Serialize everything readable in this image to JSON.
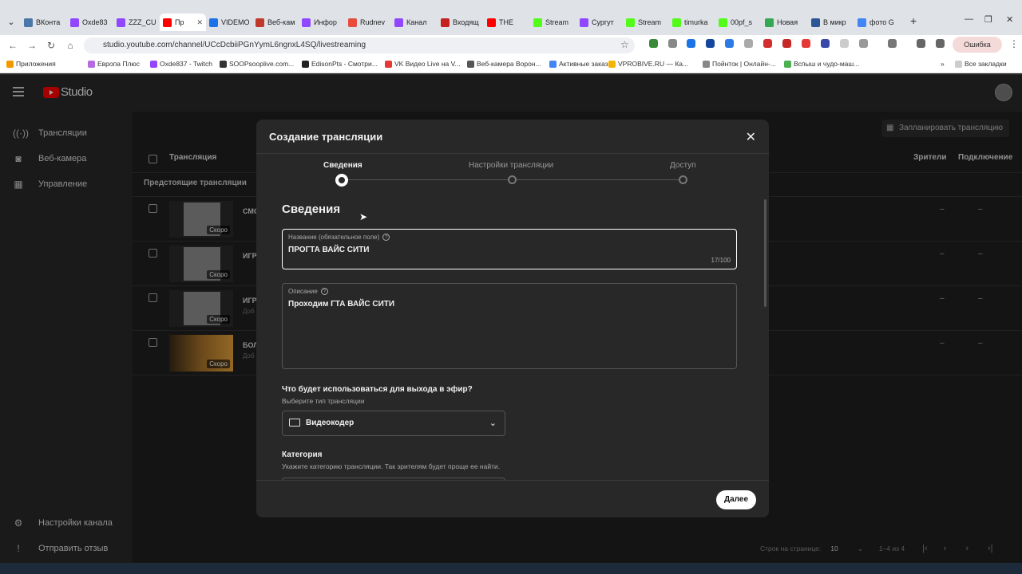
{
  "browser": {
    "tabs": [
      {
        "label": "ВКонта",
        "color": "#4a76a8"
      },
      {
        "label": "Oxde83",
        "color": "#9146ff"
      },
      {
        "label": "ZZZ_CU",
        "color": "#9146ff"
      },
      {
        "label": "Пр",
        "color": "#ff0000",
        "active": true
      },
      {
        "label": "VIDEMO",
        "color": "#1a73e8"
      },
      {
        "label": "Веб-кам",
        "color": "#c0392b"
      },
      {
        "label": "Инфор",
        "color": "#9146ff"
      },
      {
        "label": "Rudnev",
        "color": "#e84c3d"
      },
      {
        "label": "Канал",
        "color": "#9146ff"
      },
      {
        "label": "Входящ",
        "color": "#c5221f"
      },
      {
        "label": "THE",
        "color": "#ff0000"
      },
      {
        "label": "Stream",
        "color": "#53fc18"
      },
      {
        "label": "Сургут",
        "color": "#9146ff"
      },
      {
        "label": "Stream",
        "color": "#53fc18"
      },
      {
        "label": "timurka",
        "color": "#53fc18"
      },
      {
        "label": "00pf_s",
        "color": "#53fc18"
      },
      {
        "label": "Новая",
        "color": "#34a853"
      },
      {
        "label": "В микр",
        "color": "#2b5797"
      },
      {
        "label": "фото G",
        "color": "#4285f4"
      }
    ],
    "url": "studio.youtube.com/channel/UCcDcbiiPGnYymL6ngnxL4SQ/livestreaming",
    "error_label": "Ошибка",
    "bookmarks": [
      "Приложения",
      "Европа Плюс",
      "Oxde837 - Twitch",
      "SOOPsooplive.com...",
      "EdisonPts - Смотри...",
      "VK Видео Live на V...",
      "Веб-камера Ворон...",
      "Активные заказы",
      "VPROBIVE.RU — Ка...",
      "Пойнток | Онлайн-...",
      "Вспыш и чудо-маш..."
    ],
    "all_bookmarks": "Все закладки"
  },
  "studio": {
    "logo_text": "Studio",
    "sidebar": {
      "items": [
        {
          "label": "Трансляции",
          "icon": "broadcast-icon"
        },
        {
          "label": "Веб-камера",
          "icon": "camera-icon"
        },
        {
          "label": "Управление",
          "icon": "calendar-icon"
        }
      ],
      "bottom": [
        {
          "label": "Настройки канала",
          "icon": "gear-icon"
        },
        {
          "label": "Отправить отзыв",
          "icon": "feedback-icon"
        }
      ]
    },
    "schedule_button": "Запланировать трансляцию",
    "table": {
      "col_title": "Трансляция",
      "col_viewers": "Зрители",
      "col_connection": "Подключение",
      "group_label": "Предстоящие трансляции",
      "rows": [
        {
          "title": "СМО",
          "sub": "",
          "badge": "Скоро",
          "viewers": "–",
          "connection": "–"
        },
        {
          "title": "ИГРА",
          "sub": "",
          "badge": "Скоро",
          "viewers": "–",
          "connection": "–"
        },
        {
          "title": "ИГРА",
          "sub": "Доб",
          "badge": "Скоро",
          "viewers": "–",
          "connection": "–"
        },
        {
          "title": "БОЛ",
          "sub": "Доб",
          "badge": "Скоро",
          "viewers": "–",
          "connection": "–"
        }
      ]
    },
    "footer": {
      "rows_per_page_label": "Строк на странице:",
      "rows_per_page": "10",
      "range": "1–4 из 4"
    }
  },
  "modal": {
    "title": "Создание трансляции",
    "steps": [
      "Сведения",
      "Настройки трансляции",
      "Доступ"
    ],
    "active_step": 0,
    "section_title": "Сведения",
    "title_field": {
      "label": "Название (обязательное поле)",
      "value": "ПРОГТА ВАЙС СИТИ",
      "counter": "17/100"
    },
    "description_field": {
      "label": "Описание",
      "value": "Проходим ГТА ВАЙС СИТИ"
    },
    "output_question": "Что будет использоваться для выхода в эфир?",
    "output_hint": "Выберите тип трансляции",
    "output_select": "Видеокодер",
    "category_title": "Категория",
    "category_hint": "Укажите категорию трансляции. Так зрителям будет проще ее найти.",
    "next_button": "Далее"
  }
}
